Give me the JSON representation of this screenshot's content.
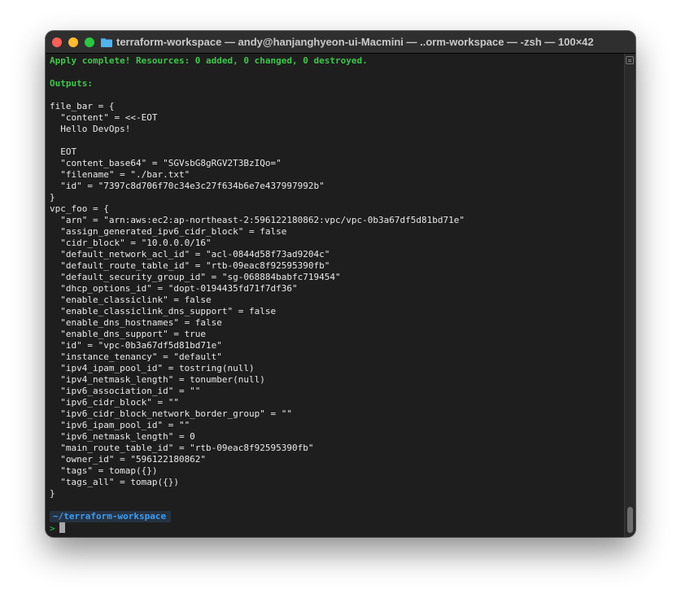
{
  "window": {
    "title": "terraform-workspace — andy@hanjanghyeon-ui-Macmini — ..orm-workspace — -zsh — 100×42"
  },
  "colors": {
    "background": "#1e1e1e",
    "green": "#3fc64a",
    "path_blue": "#3b9cf2",
    "text": "#e9e9e9"
  },
  "terminal": {
    "apply_line": "Apply complete! Resources: 0 added, 0 changed, 0 destroyed.",
    "outputs_label": "Outputs:",
    "lines": [
      "file_bar = {",
      "  \"content\" = <<-EOT",
      "  Hello DevOps!",
      "",
      "  EOT",
      "  \"content_base64\" = \"SGVsbG8gRGV2T3BzIQo=\"",
      "  \"filename\" = \"./bar.txt\"",
      "  \"id\" = \"7397c8d706f70c34e3c27f634b6e7e437997992b\"",
      "}",
      "vpc_foo = {",
      "  \"arn\" = \"arn:aws:ec2:ap-northeast-2:596122180862:vpc/vpc-0b3a67df5d81bd71e\"",
      "  \"assign_generated_ipv6_cidr_block\" = false",
      "  \"cidr_block\" = \"10.0.0.0/16\"",
      "  \"default_network_acl_id\" = \"acl-0844d58f73ad9204c\"",
      "  \"default_route_table_id\" = \"rtb-09eac8f92595390fb\"",
      "  \"default_security_group_id\" = \"sg-068884babfc719454\"",
      "  \"dhcp_options_id\" = \"dopt-0194435fd71f7df36\"",
      "  \"enable_classiclink\" = false",
      "  \"enable_classiclink_dns_support\" = false",
      "  \"enable_dns_hostnames\" = false",
      "  \"enable_dns_support\" = true",
      "  \"id\" = \"vpc-0b3a67df5d81bd71e\"",
      "  \"instance_tenancy\" = \"default\"",
      "  \"ipv4_ipam_pool_id\" = tostring(null)",
      "  \"ipv4_netmask_length\" = tonumber(null)",
      "  \"ipv6_association_id\" = \"\"",
      "  \"ipv6_cidr_block\" = \"\"",
      "  \"ipv6_cidr_block_network_border_group\" = \"\"",
      "  \"ipv6_ipam_pool_id\" = \"\"",
      "  \"ipv6_netmask_length\" = 0",
      "  \"main_route_table_id\" = \"rtb-09eac8f92595390fb\"",
      "  \"owner_id\" = \"596122180862\"",
      "  \"tags\" = tomap({})",
      "  \"tags_all\" = tomap({})",
      "}"
    ],
    "prompt_path": "~/terraform-workspace",
    "prompt_symbol": ">"
  }
}
